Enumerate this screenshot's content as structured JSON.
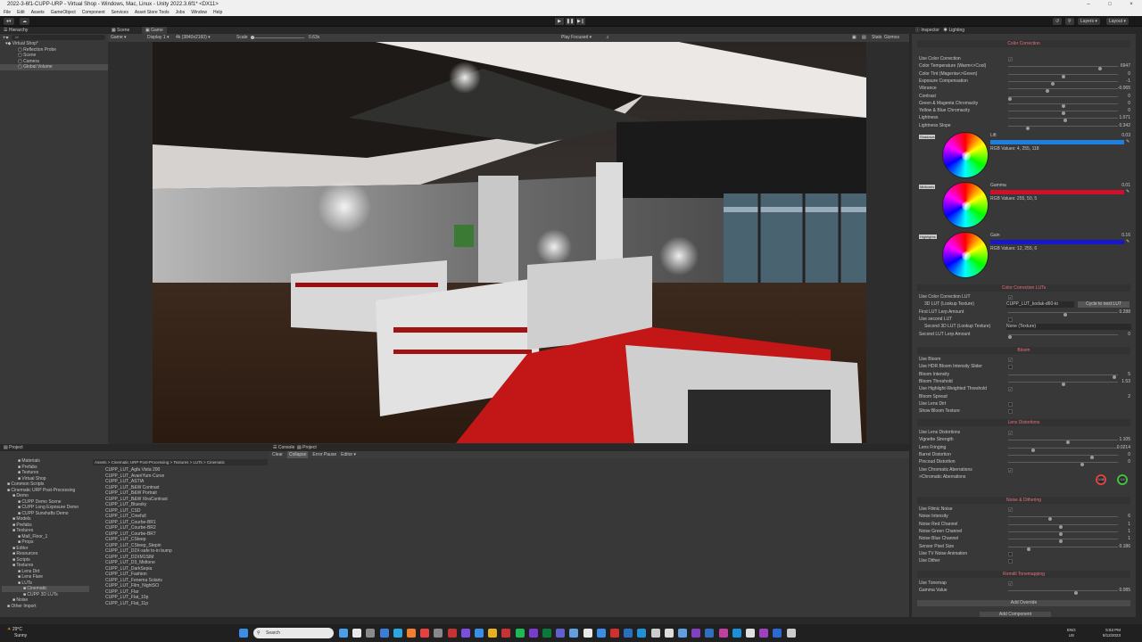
{
  "window": {
    "title": "2022-3-6f1-CUPP-URP - Virtual Shop - Windows, Mac, Linux - Unity 2022.3.6f1* <DX11>"
  },
  "menu": [
    "File",
    "Edit",
    "Assets",
    "GameObject",
    "Component",
    "Services",
    "Asset Store Tools",
    "Jobs",
    "Window",
    "Help"
  ],
  "toolbar": {
    "layers": "Layers",
    "layout": "Layout"
  },
  "hierarchy": {
    "tab": "Hierarchy",
    "search_placeholder": "All",
    "items": [
      "Virtual Shop*",
      "Reflection Probe",
      "Scene",
      "Camera",
      "Global Volume"
    ]
  },
  "game": {
    "tabs": [
      "Scene",
      "Game"
    ],
    "mode": "Game",
    "display": "Display 1",
    "resolution": "4k (3840x2160)",
    "scale_label": "Scale",
    "scale_value": "0.63x",
    "play_mode": "Play Focused",
    "stats": "Stats",
    "gizmos": "Gizmos"
  },
  "inspector": {
    "tabs": [
      "Inspector",
      "Lighting"
    ],
    "color_correction": {
      "title": "Color Correction",
      "use_label": "Use Color Correction",
      "rows": [
        {
          "label": "Color Temperature (Warm<>Cool)",
          "value": "6947",
          "pos": 0.85
        },
        {
          "label": "Color Tint (Magenta<>Green)",
          "value": "0",
          "pos": 0.5
        },
        {
          "label": "Exposure Compensation",
          "value": "-1",
          "pos": 0.4
        },
        {
          "label": "Vibrance",
          "value": "-0.065",
          "pos": 0.35
        },
        {
          "label": "Contrast",
          "value": "0",
          "pos": 0.0
        },
        {
          "label": "Green & Magenta Chromacity",
          "value": "0",
          "pos": 0.5
        },
        {
          "label": "Yellow & Blue Chromacity",
          "value": "0",
          "pos": 0.5
        },
        {
          "label": "Lightness",
          "value": "1.071",
          "pos": 0.52
        },
        {
          "label": "Lightness Slope",
          "value": "0.342",
          "pos": 0.17
        }
      ],
      "wheels": [
        {
          "tag": "Shadows",
          "name": "Lift",
          "value": "0.03",
          "rgb": "RGB Values: 4, 255, 118",
          "color": "#1e7fe0"
        },
        {
          "tag": "Midtones",
          "name": "Gamma",
          "value": "0.01",
          "rgb": "RGB Values: 255, 50, 5",
          "color": "#d0102a"
        },
        {
          "tag": "Highlights",
          "name": "Gain",
          "value": "0.16",
          "rgb": "RGB Values: 12, 255, 6",
          "color": "#1818c8"
        }
      ]
    },
    "luts": {
      "title": "Color Correction LUTs",
      "use_label": "Use Color Correction LUT",
      "lut_label": "3D LUT (Lookup Texture)",
      "lut_value": "CUPP_LUT_kodak-d60-to",
      "cycle_button": "Cycle to next LUT",
      "first_amount_label": "First LUT Lerp Amount",
      "first_amount_value": "0.288",
      "use_second_label": "Use second LUT",
      "second_lut_label": "Second 3D LUT (Lookup Texture)",
      "second_lut_value": "None (Texture)",
      "second_amount_label": "Second LUT Lerp Amount",
      "second_amount_value": "0"
    },
    "bloom": {
      "title": "Bloom",
      "use_label": "Use Bloom",
      "hdr_label": "Use HDR Bloom Intensity Slider",
      "rows": [
        {
          "label": "Bloom Intensity",
          "value": "5",
          "pos": 0.98
        },
        {
          "label": "Bloom Threshold",
          "value": "1.53",
          "pos": 0.5
        }
      ],
      "highlight_label": "Use Highlight-Weighted Threshold",
      "spread_label": "Bloom Spread",
      "spread_value": "2",
      "lens_dirt_label": "Use Lens Dirt",
      "show_texture_label": "Show Bloom Texture"
    },
    "lens": {
      "title": "Lens Distortions",
      "use_label": "Use Lens Distortions",
      "rows": [
        {
          "label": "Vignette Strength",
          "value": "1.105",
          "pos": 0.55
        },
        {
          "label": "Lens Fringing",
          "value": "0.0214",
          "pos": 0.22
        },
        {
          "label": "Barrel Distortion",
          "value": "0",
          "pos": 0.77
        },
        {
          "label": "Pincoud Distortion",
          "value": "0",
          "pos": 0.68
        }
      ],
      "chromatic_label": "Use Chromatic Aberrations",
      "chromatic_sub": ">Chromatic Aberrations",
      "knob_a": "0.08",
      "knob_b": "0.9"
    },
    "noise": {
      "title": "Noise & Dithering",
      "use_label": "Use Filmic Noise",
      "rows": [
        {
          "label": "Noise Intensity",
          "value": "6",
          "pos": 0.38
        },
        {
          "label": "Noise Red Channel",
          "value": "1",
          "pos": 0.48
        },
        {
          "label": "Noise Green Channel",
          "value": "1",
          "pos": 0.48
        },
        {
          "label": "Noise Blue Channel",
          "value": "1",
          "pos": 0.48
        },
        {
          "label": "Sensor Pixel Size",
          "value": "0.186",
          "pos": 0.18
        }
      ],
      "tv_label": "Use TV Noise Animation",
      "dither_label": "Use Dither"
    },
    "tonemap": {
      "title": "Romdil Tonemapping",
      "use_label": "Use Tonemap",
      "gamma_label": "Gamma Value",
      "gamma_value": "0.085",
      "gamma_pos": 0.62,
      "add_override": "Add Override",
      "add_component": "Add Component"
    }
  },
  "project": {
    "tab": "Project",
    "breadcrumb": "Assets > Cinematic URP Post-Processing > Textures > LUTs > Cinematic",
    "tree": [
      "Materials",
      "Prefabs",
      "Textures",
      "Virtual Shop",
      "Common Scripts",
      "Cinematic URP Post-Processing",
      "Demo",
      "CUPP Demo Scene",
      "CUPP Long Exposure Demo",
      "CUPP Sunshafts Demo",
      "Models",
      "Prefabs",
      "Textures",
      "Mall_Floor_1",
      "Props",
      "Editor",
      "Resources",
      "Scripts",
      "Textures",
      "Lens Dirt",
      "Lens Flare",
      "LUTs",
      "Cinematic",
      "CUPP 3D LUTs",
      "Noise",
      "Other Import"
    ],
    "files": [
      "CUPP_LUT_Agfa Vista 200",
      "CUPP_LUT_AvaniYum-Curve",
      "CUPP_LUT_ASTIA",
      "CUPP_LUT_B&W Contrast",
      "CUPP_LUT_B&W Portrait",
      "CUPP_LUT_B&W XtraContrast",
      "CUPP_LUT_Bluesky",
      "CUPP_LUT_CSD",
      "CUPP_LUT_Cinefull",
      "CUPP_LUT_Courbe-BR1",
      "CUPP_LUT_Courbe-BR2",
      "CUPP_LUT_Courbe-BR7",
      "CUPP_LUT_CSteep",
      "CUPP_LUT_CSteep_Stepin",
      "CUPP_LUT_D2X-safe to-in bump",
      "CUPP_LUT_D2XM1SIM",
      "CUPP_LUT_D3_Midtone",
      "CUPP_LUT_DarkSepia",
      "CUPP_LUT_Fashion",
      "CUPP_LUT_Fenema Solaris",
      "CUPP_LUT_Film_NightSO",
      "CUPP_LUT_Flar",
      "CUPP_LUT_Flat_10p",
      "CUPP_LUT_Flat_11p"
    ]
  },
  "console": {
    "tabs": [
      "Console",
      "Project"
    ],
    "clear": "Clear",
    "collapse": "Collapse",
    "error_pause": "Error Pause",
    "editor": "Editor"
  },
  "taskbar": {
    "weather_temp": "29°C",
    "weather_text": "Sunny",
    "search": "Search",
    "lang": "ENG",
    "region": "US",
    "time": "5:53 PM",
    "date": "8/12/2023"
  }
}
